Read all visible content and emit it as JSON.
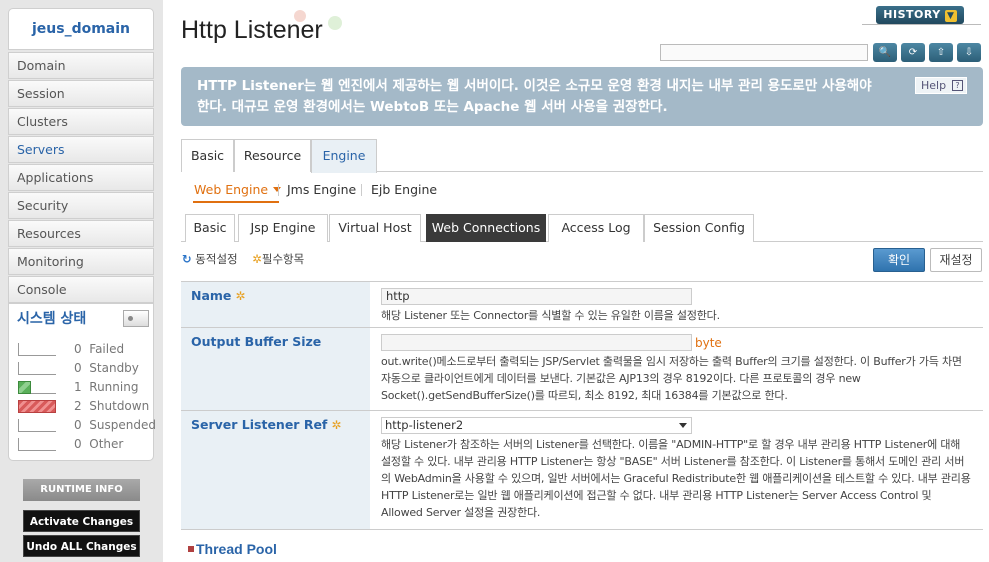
{
  "sidebar": {
    "domain": "jeus_domain",
    "items": [
      {
        "label": "Domain"
      },
      {
        "label": "Session"
      },
      {
        "label": "Clusters"
      },
      {
        "label": "Servers"
      },
      {
        "label": "Applications"
      },
      {
        "label": "Security"
      },
      {
        "label": "Resources"
      },
      {
        "label": "Monitoring"
      },
      {
        "label": "Console"
      }
    ],
    "system_status": {
      "title": "시스템 상태",
      "states": [
        {
          "count": "0",
          "label": "Failed"
        },
        {
          "count": "0",
          "label": "Standby"
        },
        {
          "count": "1",
          "label": "Running"
        },
        {
          "count": "2",
          "label": "Shutdown"
        },
        {
          "count": "0",
          "label": "Suspended"
        },
        {
          "count": "0",
          "label": "Other"
        }
      ]
    },
    "runtime_info": "RUNTIME INFO",
    "activate_changes": "Activate Changes",
    "undo_changes": "Undo ALL Changes"
  },
  "header": {
    "title": "Http Listener",
    "history": "HISTORY",
    "search_value": ""
  },
  "banner": {
    "text": "HTTP Listener는 웹 엔진에서 제공하는 웹 서버이다. 이것은 소규모 운영 환경 내지는 내부 관리 용도로만 사용해야 한다. 대규모 운영 환경에서는 WebtoB 또는 Apache 웹 서버 사용을 권장한다.",
    "help": "Help"
  },
  "tabs": [
    "Basic",
    "Resource",
    "Engine"
  ],
  "subnav": [
    "Web Engine",
    "Jms Engine",
    "Ejb Engine"
  ],
  "subtabs": [
    "Basic",
    "Jsp Engine",
    "Virtual Host",
    "Web Connections",
    "Access Log",
    "Session Config"
  ],
  "legend": {
    "dynamic": "동적설정",
    "required": "필수항목"
  },
  "actions": {
    "ok": "확인",
    "reset": "재설정"
  },
  "form": {
    "name": {
      "label": "Name",
      "value": "http",
      "desc": "해당 Listener 또는 Connector를 식별할 수 있는 유일한 이름을 설정한다."
    },
    "output_buffer": {
      "label": "Output Buffer Size",
      "value": "",
      "unit": "byte",
      "desc": "out.write()메소드로부터 출력되는 JSP/Servlet 출력물을 임시 저장하는 출력 Buffer의 크기를 설정한다. 이 Buffer가 가득 차면 자동으로 클라이언트에게 데이터를 보낸다. 기본값은 AJP13의 경우 8192이다. 다른 프로토콜의 경우 new Socket().getSendBufferSize()를 따르되, 최소 8192, 최대 16384를 기본값으로 한다."
    },
    "server_listener": {
      "label": "Server Listener Ref",
      "value": "http-listener2",
      "desc": "해당 Listener가 참조하는 서버의 Listener를 선택한다. 이름을 \"ADMIN-HTTP\"로 할 경우 내부 관리용 HTTP Listener에 대해 설정할 수 있다. 내부 관리용 HTTP Listener는 항상 \"BASE\" 서버 Listener를 참조한다. 이 Listener를 통해서 도메인 관리 서버의 WebAdmin을 사용할 수 있으며, 일반 서버에서는 Graceful Redistribute한 웹 애플리케이션을 테스트할 수 있다. 내부 관리용 HTTP Listener로는 일반 웹 애플리케이션에 접근할 수 없다. 내부 관리용 HTTP Listener는 Server Access Control 및 Allowed Server 설정을 권장한다."
    }
  },
  "section": {
    "thread_pool": "Thread Pool"
  }
}
